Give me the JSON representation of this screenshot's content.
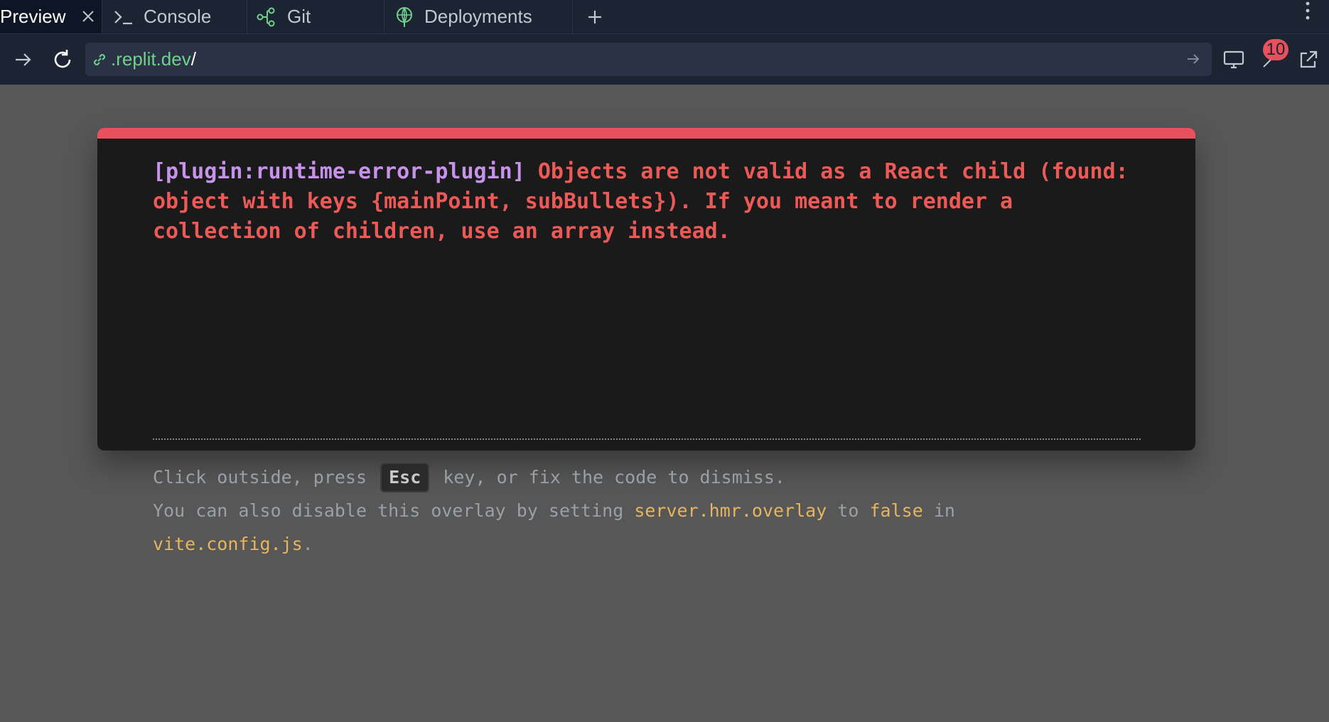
{
  "tabs": [
    {
      "label": "Preview",
      "icon": "close-icon",
      "active": true
    },
    {
      "label": "Console",
      "icon": "terminal-icon",
      "active": false
    },
    {
      "label": "Git",
      "icon": "git-branch-icon",
      "active": false
    },
    {
      "label": "Deployments",
      "icon": "globe-icon",
      "active": false
    }
  ],
  "address": {
    "url_host": ".replit.dev",
    "url_path": "/"
  },
  "toolbar": {
    "badge_count": "10"
  },
  "error": {
    "plugin": "[plugin:runtime-error-plugin]",
    "message": "Objects are not valid as a React child (found: object with keys {mainPoint, subBullets}). If you meant to render a collection of children, use an array instead.",
    "tip_prefix": "Click outside, press",
    "tip_key": "Esc",
    "tip_suffix": "key, or fix the code to dismiss.",
    "tip2_a": "You can also disable this overlay by setting",
    "tip2_setting": "server.hmr.overlay",
    "tip2_b": "to",
    "tip2_value": "false",
    "tip2_c": "in",
    "tip2_file": "vite.config.js",
    "tip2_end": "."
  },
  "colors": {
    "error_red": "#e8505b",
    "plugin_purple": "#c792ea",
    "code_yellow": "#e5b55f",
    "url_green": "#6fd18b"
  }
}
